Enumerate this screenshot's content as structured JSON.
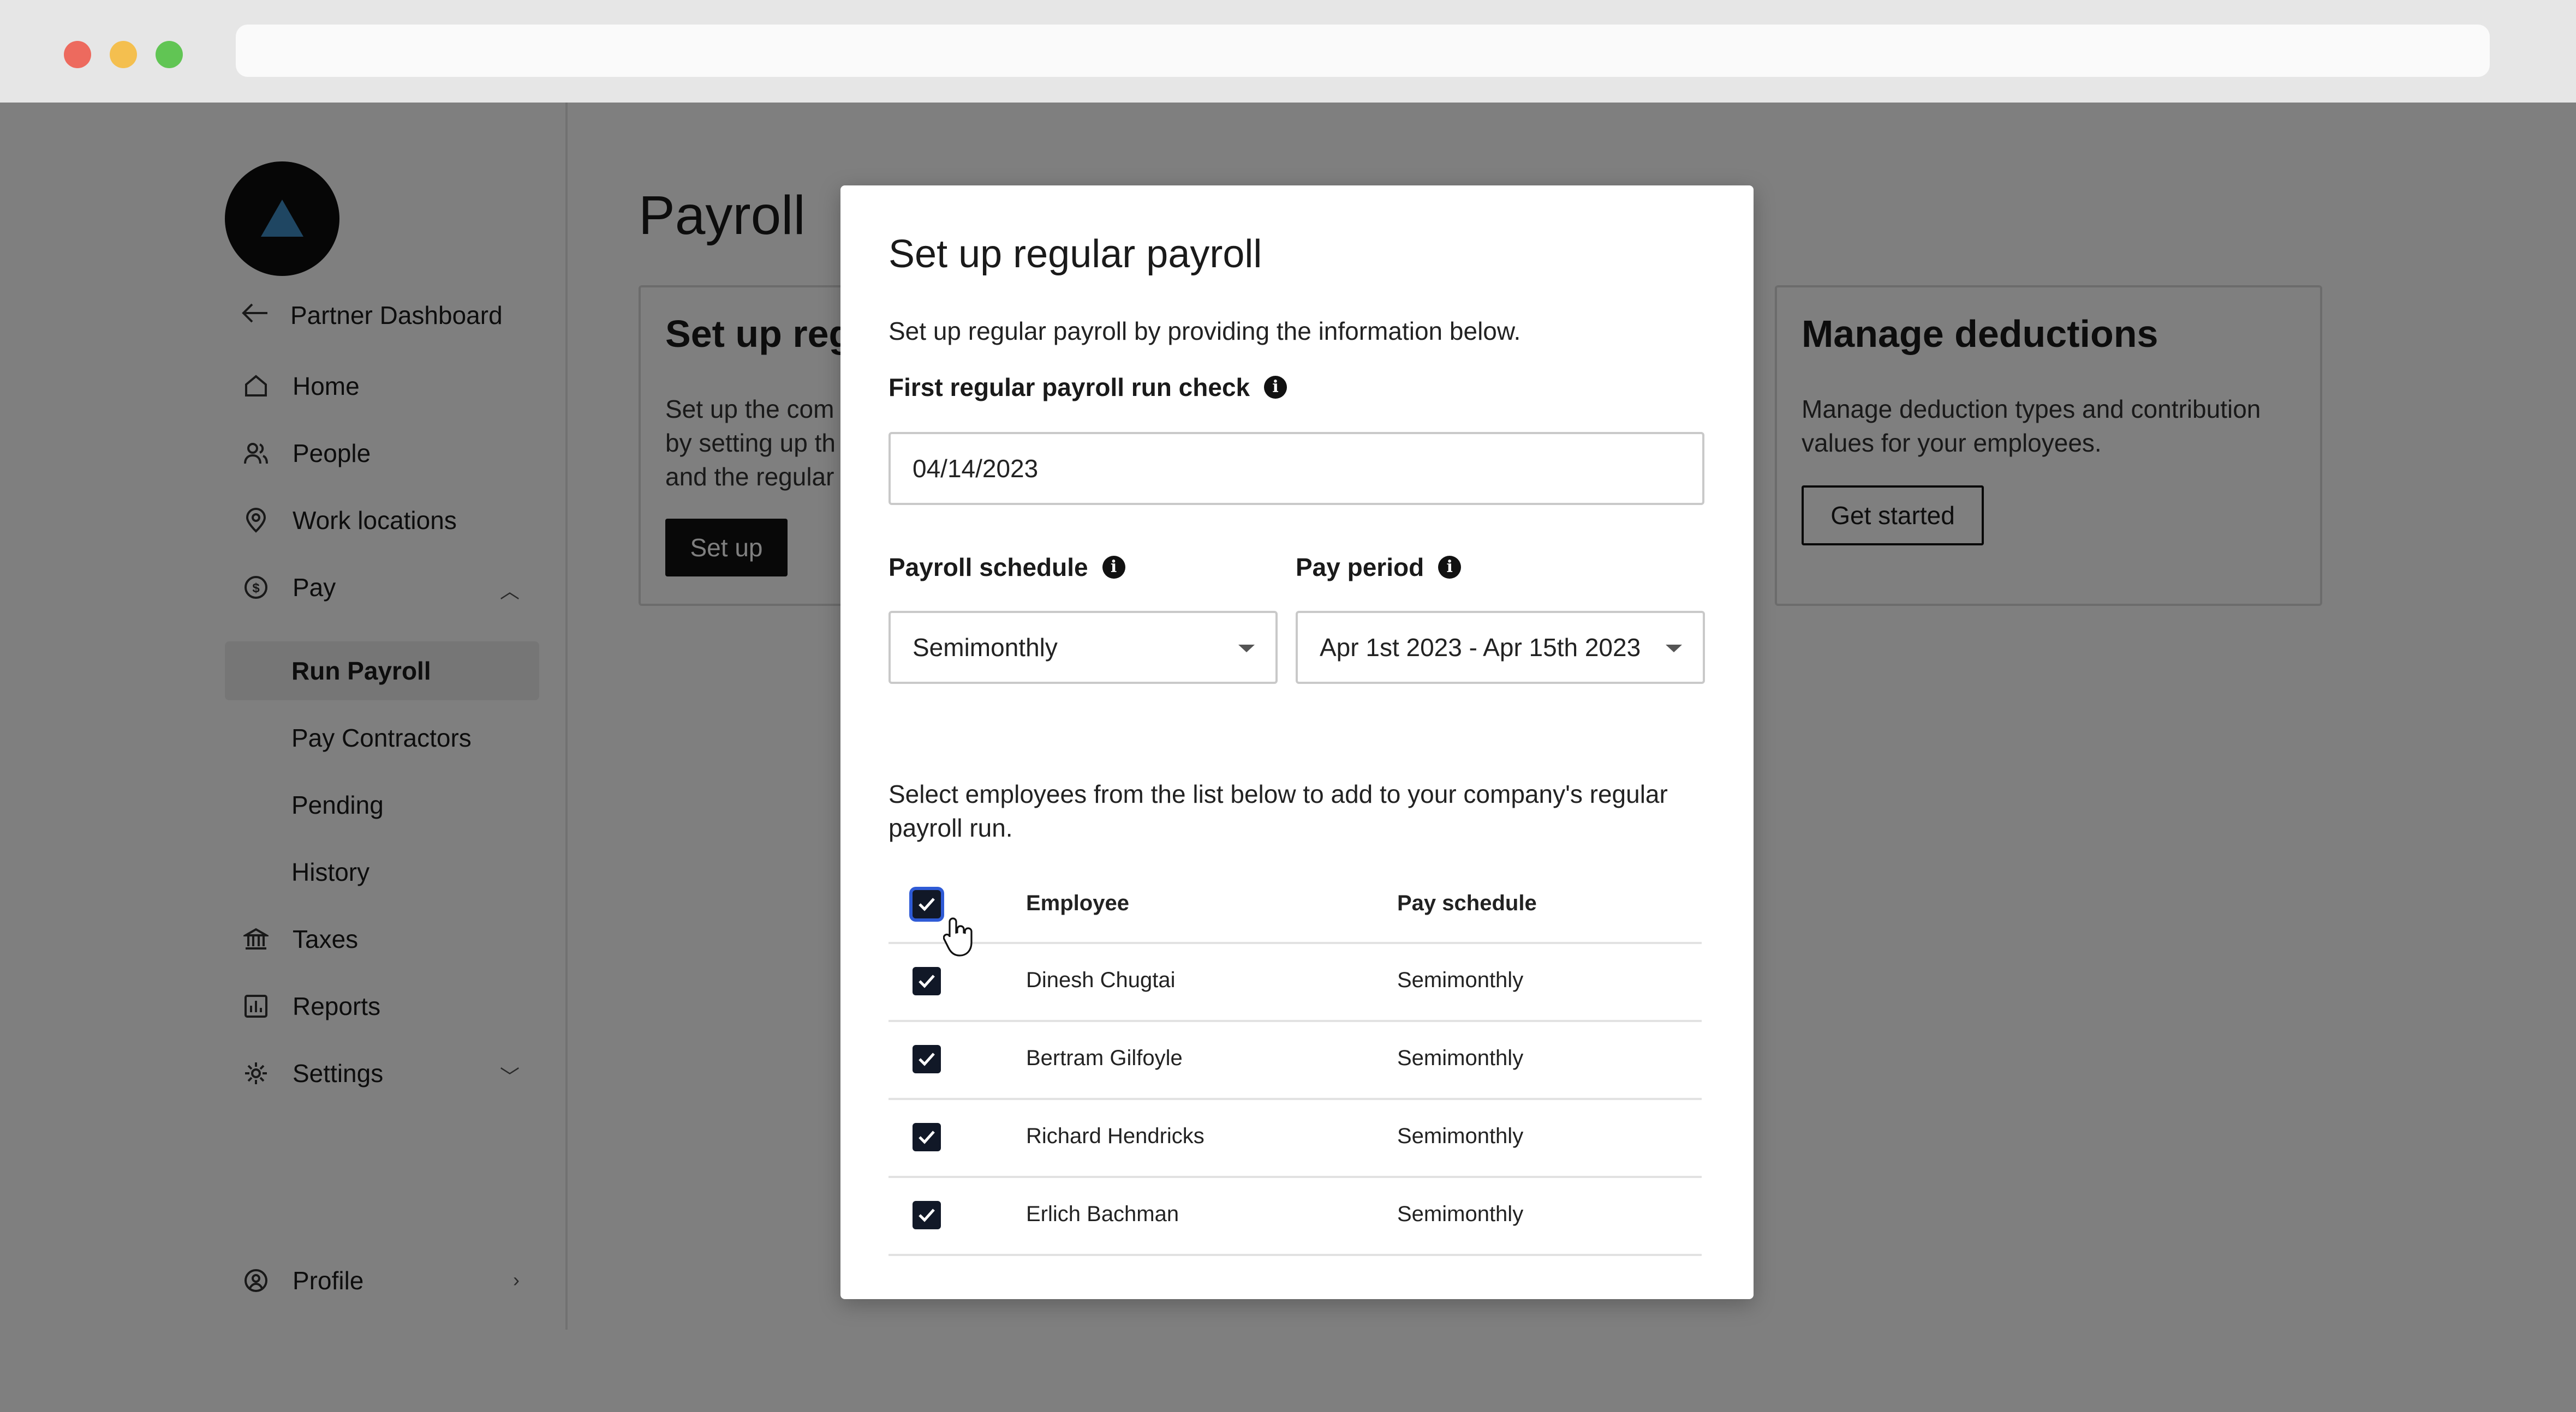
{
  "sidebar": {
    "back_label": "Partner Dashboard",
    "items": [
      {
        "label": "Home",
        "icon": "home-icon"
      },
      {
        "label": "People",
        "icon": "people-icon"
      },
      {
        "label": "Work locations",
        "icon": "location-pin-icon"
      },
      {
        "label": "Pay",
        "icon": "dollar-circle-icon"
      },
      {
        "label": "Taxes",
        "icon": "bank-icon"
      },
      {
        "label": "Reports",
        "icon": "chart-icon"
      },
      {
        "label": "Settings",
        "icon": "gear-icon"
      }
    ],
    "pay_subitems": [
      "Run Payroll",
      "Pay Contractors",
      "Pending",
      "History"
    ],
    "active_subitem": "Run Payroll",
    "profile_label": "Profile"
  },
  "main": {
    "title": "Payroll",
    "setup_card": {
      "title": "Set up reg",
      "description": [
        "Set up the com",
        "by setting up th",
        "and the regular"
      ],
      "button": "Set up"
    },
    "deductions_card": {
      "title": "Manage deductions",
      "description": "Manage deduction types and contribution values for your employees.",
      "button": "Get started"
    }
  },
  "modal": {
    "title": "Set up regular payroll",
    "description": "Set up regular payroll by providing the information below.",
    "first_check_label": "First regular payroll run check",
    "first_check_value": "04/14/2023",
    "schedule_label": "Payroll schedule",
    "schedule_value": "Semimonthly",
    "pay_period_label": "Pay period",
    "pay_period_value": "Apr 1st 2023 - Apr 15th 2023",
    "helper_text": "Select employees from the list below to add to your company's regular payroll run.",
    "table": {
      "columns": [
        "Employee",
        "Pay schedule"
      ],
      "rows": [
        {
          "employee": "Dinesh Chugtai",
          "schedule": "Semimonthly",
          "checked": true
        },
        {
          "employee": "Bertram Gilfoyle",
          "schedule": "Semimonthly",
          "checked": true
        },
        {
          "employee": "Richard Hendricks",
          "schedule": "Semimonthly",
          "checked": true
        },
        {
          "employee": "Erlich Bachman",
          "schedule": "Semimonthly",
          "checked": true
        }
      ],
      "select_all_checked": true
    }
  }
}
